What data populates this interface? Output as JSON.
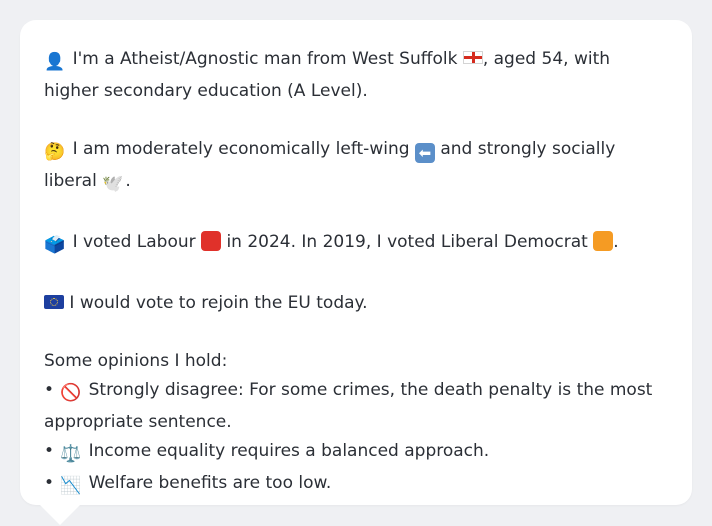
{
  "profile": {
    "identity_icon": "person-silhouette-icon",
    "identity_text_1": "I'm a Atheist/Agnostic man from West Suffolk",
    "identity_text_2": ", aged 54, with higher secondary education (A Level).",
    "politics_icon": "thinking-face-icon",
    "politics_text_1": "I am moderately economically left-wing",
    "politics_text_2": "and strongly socially liberal",
    "politics_text_3": ".",
    "vote_icon": "ballot-box-icon",
    "vote_text_1": "I voted Labour",
    "vote_text_2": "in 2024. In 2019, I voted Liberal Democrat",
    "vote_text_3": ".",
    "eu_icon": "eu-flag-icon",
    "eu_text": "I would vote to rejoin the EU today.",
    "opinions_heading": "Some opinions I hold:",
    "opinions": [
      {
        "bullet": "•",
        "icon": "prohibited-icon",
        "glyph": "🚫",
        "text": "Strongly disagree: For some crimes, the death penalty is the most appropriate sentence."
      },
      {
        "bullet": "•",
        "icon": "balance-scale-icon",
        "glyph": "⚖️",
        "text": "Income equality requires a balanced approach."
      },
      {
        "bullet": "•",
        "icon": "chart-decreasing-icon",
        "glyph": "📉",
        "text": "Welfare benefits are too low."
      }
    ]
  },
  "colors": {
    "labour_red": "#e0312a",
    "libdem_orange": "#f59b23",
    "england_flag_red": "#d52b1e",
    "eu_blue": "#1d3f9f",
    "background": "#eff0f3",
    "card": "#ffffff"
  }
}
